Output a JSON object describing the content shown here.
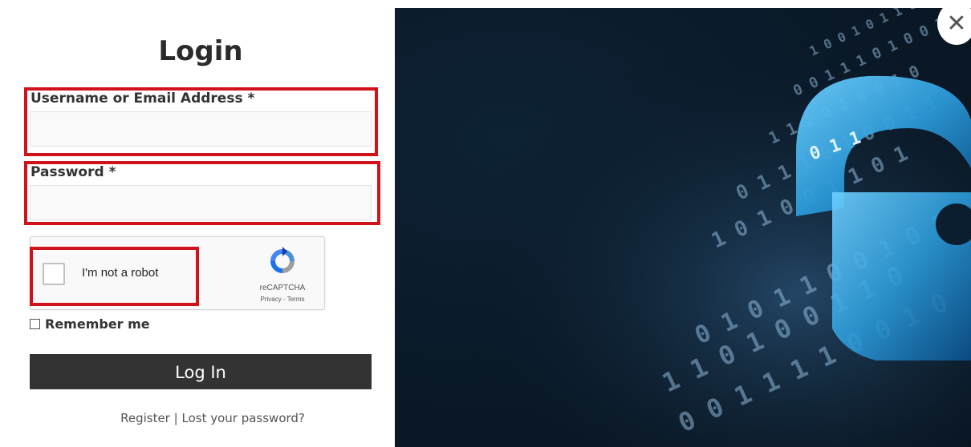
{
  "form": {
    "title": "Login",
    "username_label": "Username or Email Address *",
    "username_value": "",
    "password_label": "Password *",
    "password_value": "",
    "remember_label": "Remember me",
    "submit_label": "Log In",
    "register_link": "Register",
    "separator": "|",
    "lost_password_link": "Lost your password?"
  },
  "recaptcha": {
    "label": "I'm not a robot",
    "brand": "reCAPTCHA",
    "privacy": "Privacy",
    "dash": "-",
    "terms": "Terms"
  },
  "image": {
    "binary_rows": [
      "0 1 0 1 1 0 0 1 0 1",
      "1 1 0 1 0 0 1 1 0",
      "0 0 1 1 1 1 0 0 1 0",
      "1 0 1 0 0 1 1 0 1",
      "0 1 1 1 0 1 0 0 1 1",
      "1 1 1 0 1 0 0 1 0",
      "0 0 1 1 1 0 1 0 0 1",
      "1 0 0 1 0 1 1 0 1 0"
    ],
    "lock_digits": "0 1 1"
  },
  "colors": {
    "highlight": "#d0131b",
    "button_bg": "#333333",
    "lock_blue": "#3aa9e6"
  },
  "close_icon": "close-icon"
}
